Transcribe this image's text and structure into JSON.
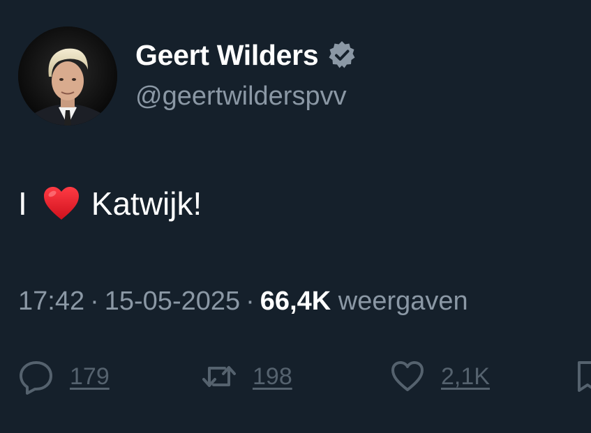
{
  "author": {
    "display_name": "Geert Wilders",
    "handle": "@geertwilderspvv",
    "verified": true
  },
  "tweet": {
    "text_before": "I",
    "emoji": "red-heart",
    "text_after": "Katwijk!"
  },
  "meta": {
    "time": "17:42",
    "separator": "·",
    "date": "15-05-2025",
    "views_count": "66,4K",
    "views_label": "weergaven"
  },
  "actions": {
    "replies": "179",
    "reposts": "198",
    "likes": "2,1K"
  },
  "colors": {
    "background": "#15202b",
    "primary_text": "#ffffff",
    "secondary_text": "#8b98a5",
    "heart": "#e0202f"
  }
}
